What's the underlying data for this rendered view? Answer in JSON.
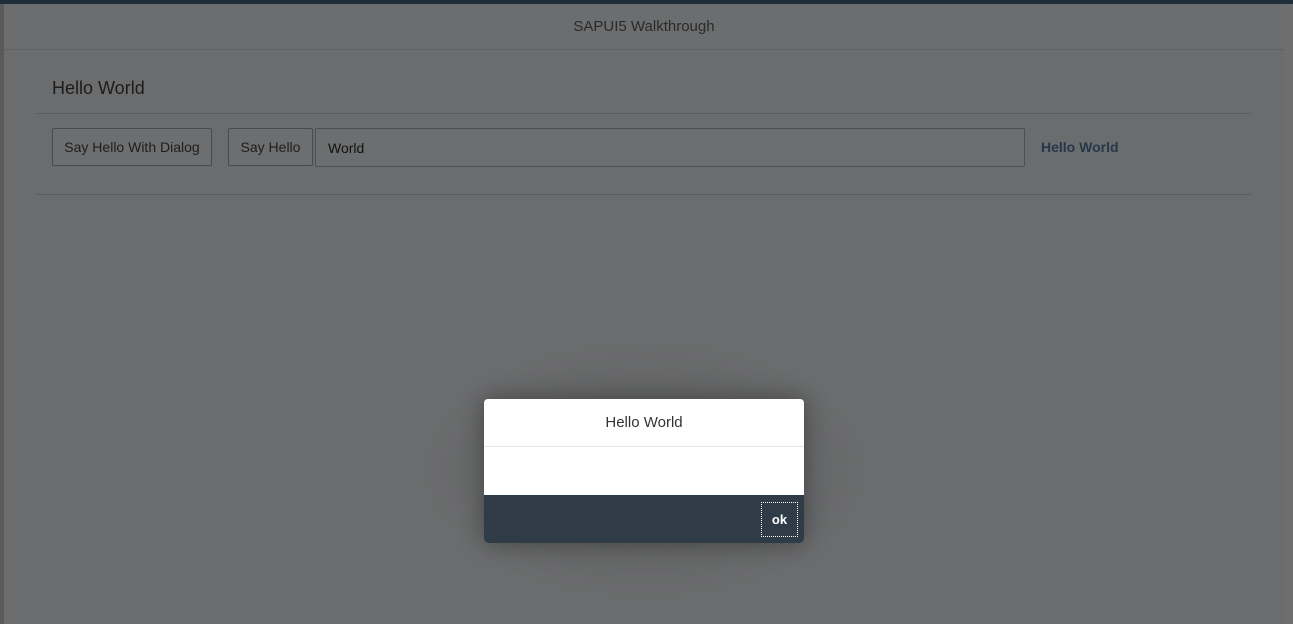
{
  "app": {
    "title": "SAPUI5 Walkthrough"
  },
  "panel": {
    "title": "Hello World",
    "dialog_button_label": "Say Hello With Dialog",
    "hello_button_label": "Say Hello",
    "name_input_value": "World",
    "greeting_text": "Hello World"
  },
  "dialog": {
    "title": "Hello World",
    "ok_label": "ok"
  },
  "colors": {
    "shell_header": "#1e2e3b",
    "dialog_footer": "#2f3c48",
    "greeting_text": "#253849"
  }
}
